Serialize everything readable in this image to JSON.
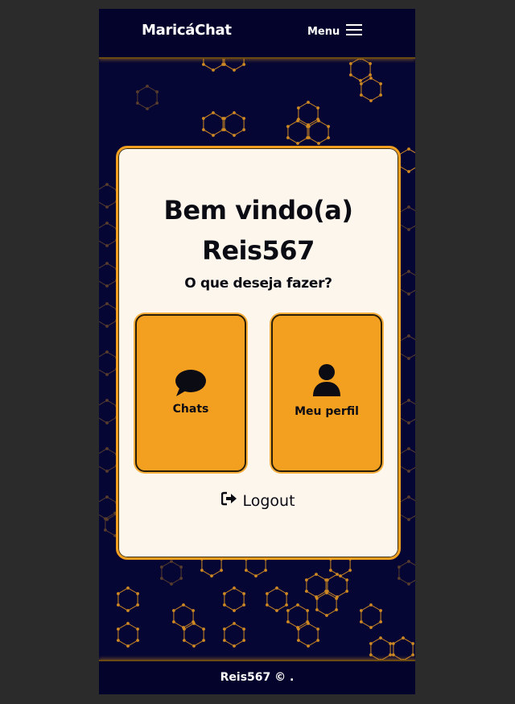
{
  "header": {
    "brand": "MaricáChat",
    "menu_label": "Menu",
    "menu_icon": "hamburger-icon"
  },
  "card": {
    "welcome": "Bem vindo(a)",
    "username": "Reis567",
    "question": "O que deseja fazer?",
    "tiles": [
      {
        "label": "Chats",
        "icon": "chat-bubble-icon"
      },
      {
        "label": "Meu perfil",
        "icon": "user-icon"
      }
    ],
    "logout_label": "Logout",
    "logout_icon": "sign-out-icon"
  },
  "footer": {
    "text": "Reis567 © ."
  },
  "colors": {
    "background": "#050634",
    "bar": "#03032b",
    "accent": "#f3a020",
    "card": "#fdf6ec",
    "text_dark": "#0b0b14"
  }
}
